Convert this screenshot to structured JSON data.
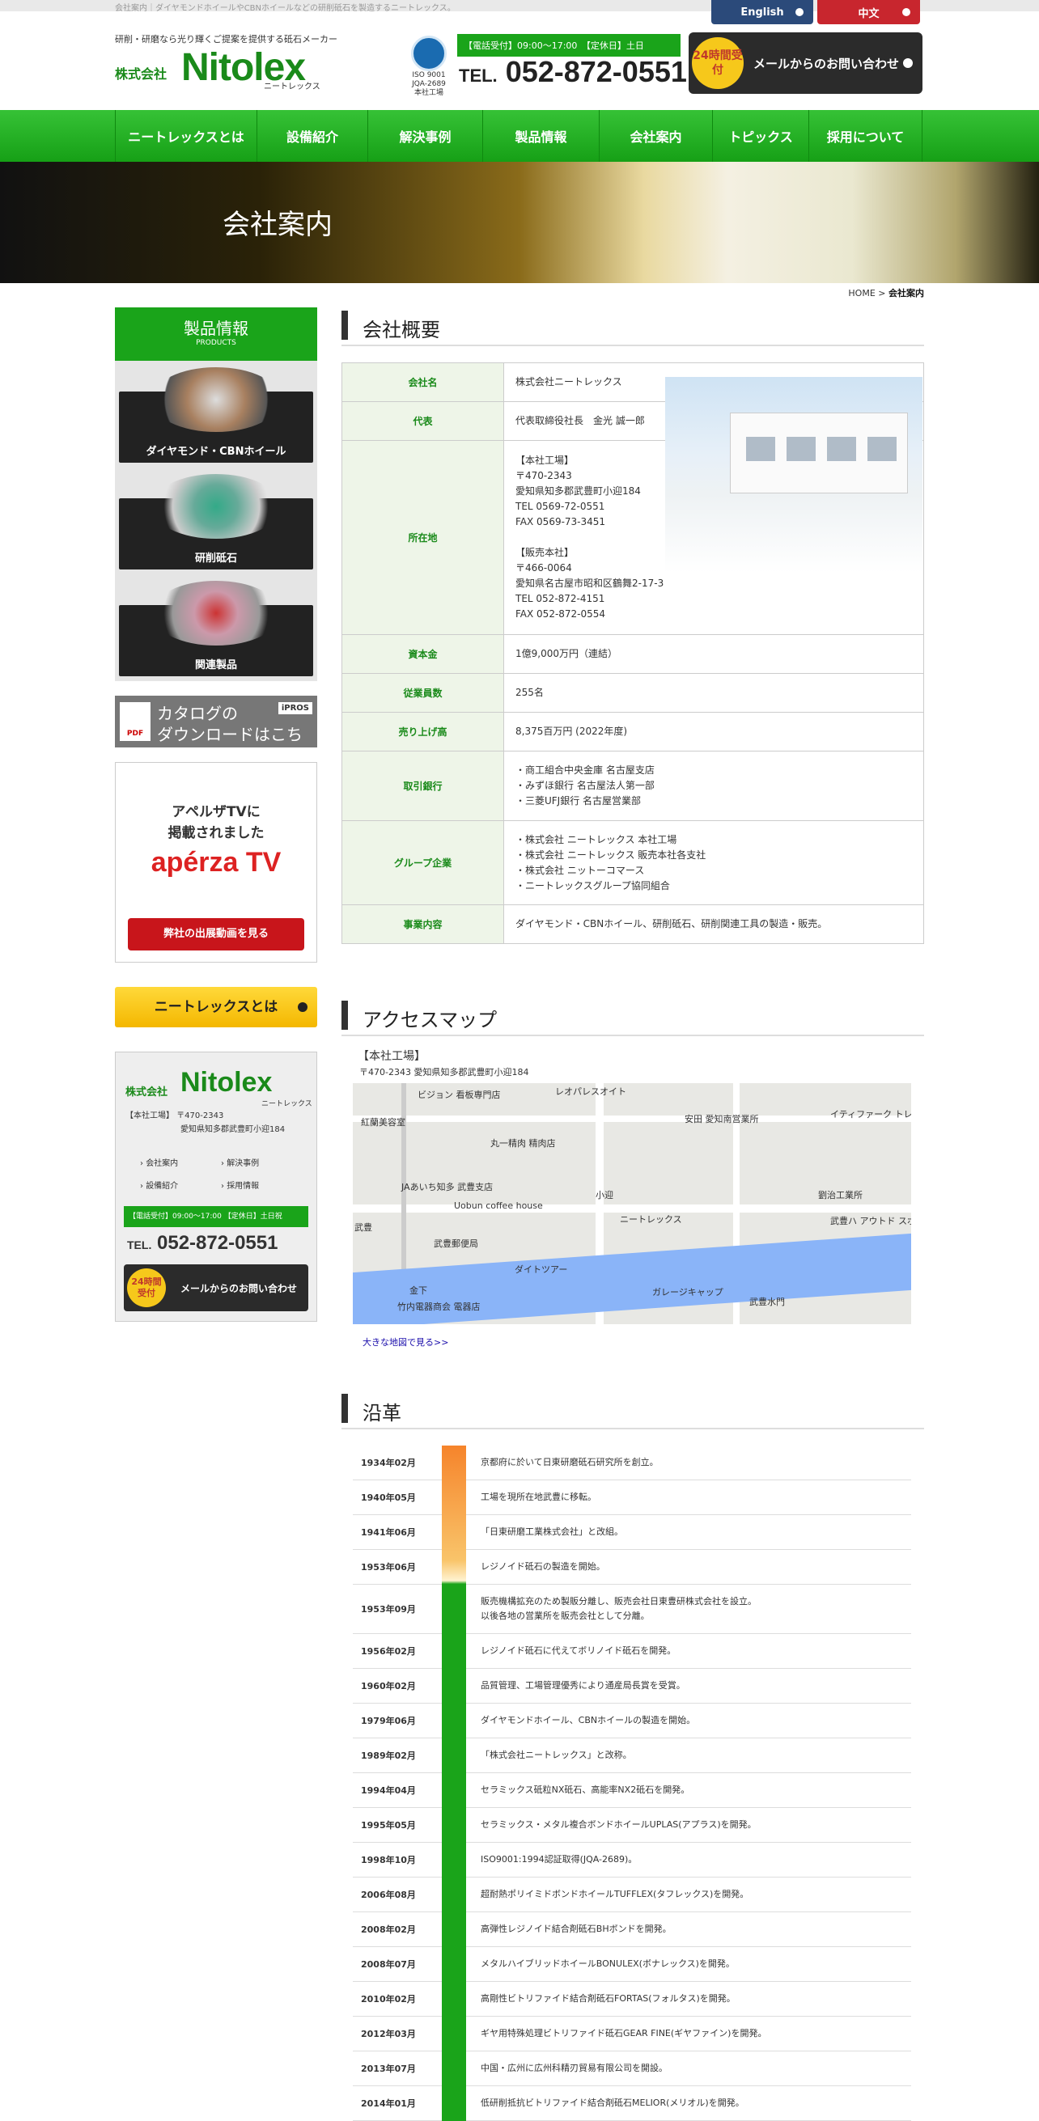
{
  "top": {
    "tagline": "会社案内｜ダイヤモンドホイールやCBNホイールなどの研削砥石を製造するニートレックス。"
  },
  "lang": {
    "en": "English",
    "cn": "中文"
  },
  "header": {
    "subtitle": "研削・研磨なら光り輝くご提案を提供する砥石メーカー",
    "company": "株式会社",
    "logo": "Nitolex",
    "kana": "ニートレックス",
    "iso": [
      "ISO 9001",
      "JQA-2689",
      "本社工場"
    ],
    "phone_bar": "【電話受付】09:00～17:00　【定休日】土日",
    "phone_prefix": "TEL.",
    "phone": "052-872-0551",
    "mail_badge": "24時間受付",
    "mail_label": "メールからのお問い合わせ"
  },
  "nav": [
    "ニートレックスとは",
    "設備紹介",
    "解決事例",
    "製品情報",
    "会社案内",
    "トピックス",
    "採用について"
  ],
  "banner": {
    "title": "会社案内"
  },
  "breadcrumb": {
    "home": "HOME",
    "sep": " > ",
    "current": "会社案内"
  },
  "sidebar": {
    "products_title": "製品情報",
    "products_sub": "PRODUCTS",
    "products": [
      "ダイヤモンド・CBNホイール",
      "研削砥石",
      "関連製品"
    ],
    "catalog": {
      "pdf": "PDF",
      "line1": "カタログの",
      "line2": "ダウンロードはこちら",
      "ipros": "iPROS"
    },
    "aperza": {
      "line1": "アペルザTVに",
      "line2": "掲載されました",
      "logo": "apérza TV",
      "button": "弊社の出展動画を見る"
    },
    "about_button": "ニートレックスとは",
    "address": {
      "company": "株式会社",
      "logo": "Nitolex",
      "kana": "ニートレックス",
      "line1": "【本社工場】 〒470-2343",
      "line2": "愛知県知多郡武豊町小迎184",
      "links": [
        "会社案内",
        "解決事例",
        "設備紹介",
        "採用情報"
      ],
      "phone_bar": "【電話受付】09:00～17:00 【定休日】土日祝",
      "phone_prefix": "TEL.",
      "phone": "052-872-0551",
      "mail_badge": "24時間受付",
      "mail_label": "メールからのお問い合わせ"
    }
  },
  "overview": {
    "title": "会社概要",
    "rows": [
      {
        "k": "会社名",
        "v": "株式会社ニートレックス"
      },
      {
        "k": "代表",
        "v": "代表取締役社長　金光 誠一郎"
      },
      {
        "k": "所在地",
        "v": "【本社工場】\n〒470-2343\n愛知県知多郡武豊町小迎184\nTEL 0569-72-0551\nFAX 0569-73-3451\n\n【販売本社】\n〒466-0064\n愛知県名古屋市昭和区鶴舞2-17-3\nTEL 052-872-4151\nFAX 052-872-0554"
      },
      {
        "k": "資本金",
        "v": "1億9,000万円（連結）"
      },
      {
        "k": "従業員数",
        "v": "255名"
      },
      {
        "k": "売り上げ高",
        "v": "8,375百万円 (2022年度)"
      },
      {
        "k": "取引銀行",
        "v": "・商工組合中央金庫 名古屋支店\n・みずほ銀行 名古屋法人第一部\n・三菱UFJ銀行 名古屋営業部"
      },
      {
        "k": "グループ企業",
        "v": "・株式会社 ニートレックス 本社工場\n・株式会社 ニートレックス 販売本社各支社\n・株式会社 ニットーコマース\n・ニートレックスグループ協同組合"
      },
      {
        "k": "事業内容",
        "v": "ダイヤモンド・CBNホイール、研削砥石、研削関連工具の製造・販売。"
      }
    ]
  },
  "access": {
    "title": "アクセスマップ",
    "label": "【本社工場】",
    "address": "〒470-2343 愛知県知多郡武豊町小迎184",
    "map_labels": [
      "レオパレスオイト",
      "ビジョン 看板専門店",
      "紅蘭美容室",
      "丸一精肉 精肉店",
      "安田 愛知南営業所",
      "イティファーク トレーディング 自動車販売店",
      "JAあいち知多 武豊支店",
      "小迎",
      "Uobun coffee house",
      "ニートレックス",
      "劉治工業所",
      "武豊ハ アウトド スポーツ",
      "武豊",
      "武豊郵便局",
      "ダイトツアー",
      "ガレージキャップ",
      "金下",
      "竹内電器商会 電器店",
      "武豊水門"
    ],
    "link": "大きな地図で見る>>"
  },
  "history": {
    "title": "沿革",
    "rows": [
      {
        "d": "1934年02月",
        "t": "京都府に於いて日東研磨砥石研究所を創立。"
      },
      {
        "d": "1940年05月",
        "t": "工場を現所在地武豊に移転。"
      },
      {
        "d": "1941年06月",
        "t": "「日東研磨工業株式会社」と改組。"
      },
      {
        "d": "1953年06月",
        "t": "レジノイド砥石の製造を開始。"
      },
      {
        "d": "1953年09月",
        "t": "販売機構拡充のため製販分離し、販売会社日東豊研株式会社を設立。\n以後各地の営業所を販売会社として分離。"
      },
      {
        "d": "1956年02月",
        "t": "レジノイド砥石に代えてボリノイド砥石を開発。"
      },
      {
        "d": "1960年02月",
        "t": "品質管理、工場管理優秀により通産局長賞を受賞。"
      },
      {
        "d": "1979年06月",
        "t": "ダイヤモンドホイール、CBNホイールの製造を開始。"
      },
      {
        "d": "1989年02月",
        "t": "「株式会社ニートレックス」と改称。"
      },
      {
        "d": "1994年04月",
        "t": "セラミックス砥粒NX砥石、高能率NX2砥石を開発。"
      },
      {
        "d": "1995年05月",
        "t": "セラミックス・メタル複合ボンドホイールUPLAS(アプラス)を開発。"
      },
      {
        "d": "1998年10月",
        "t": "ISO9001:1994認証取得(JQA-2689)。"
      },
      {
        "d": "2006年08月",
        "t": "超耐熱ポリイミドボンドホイールTUFFLEX(タフレックス)を開発。"
      },
      {
        "d": "2008年02月",
        "t": "高弾性レジノイド結合剤砥石BHボンドを開発。"
      },
      {
        "d": "2008年07月",
        "t": "メタルハイブリッドホイールBONULEX(ボナレックス)を開発。"
      },
      {
        "d": "2010年02月",
        "t": "高剛性ビトリファイド結合剤砥石FORTAS(フォルタス)を開発。"
      },
      {
        "d": "2012年03月",
        "t": "ギヤ用特殊処理ビトリファイド砥石GEAR FINE(ギヤファイン)を開発。"
      },
      {
        "d": "2013年07月",
        "t": "中国・広州に広州科精刃貿易有限公司を開設。"
      },
      {
        "d": "2014年01月",
        "t": "低研削抵抗ビトリファイド結合剤砥石MELIOR(メリオル)を開発。"
      }
    ]
  },
  "colors": {
    "green": "#1aa41a",
    "dark_green": "#1a8a1a",
    "timeline_top": "#f6842b",
    "timeline_bottom": "#1aa41a"
  }
}
